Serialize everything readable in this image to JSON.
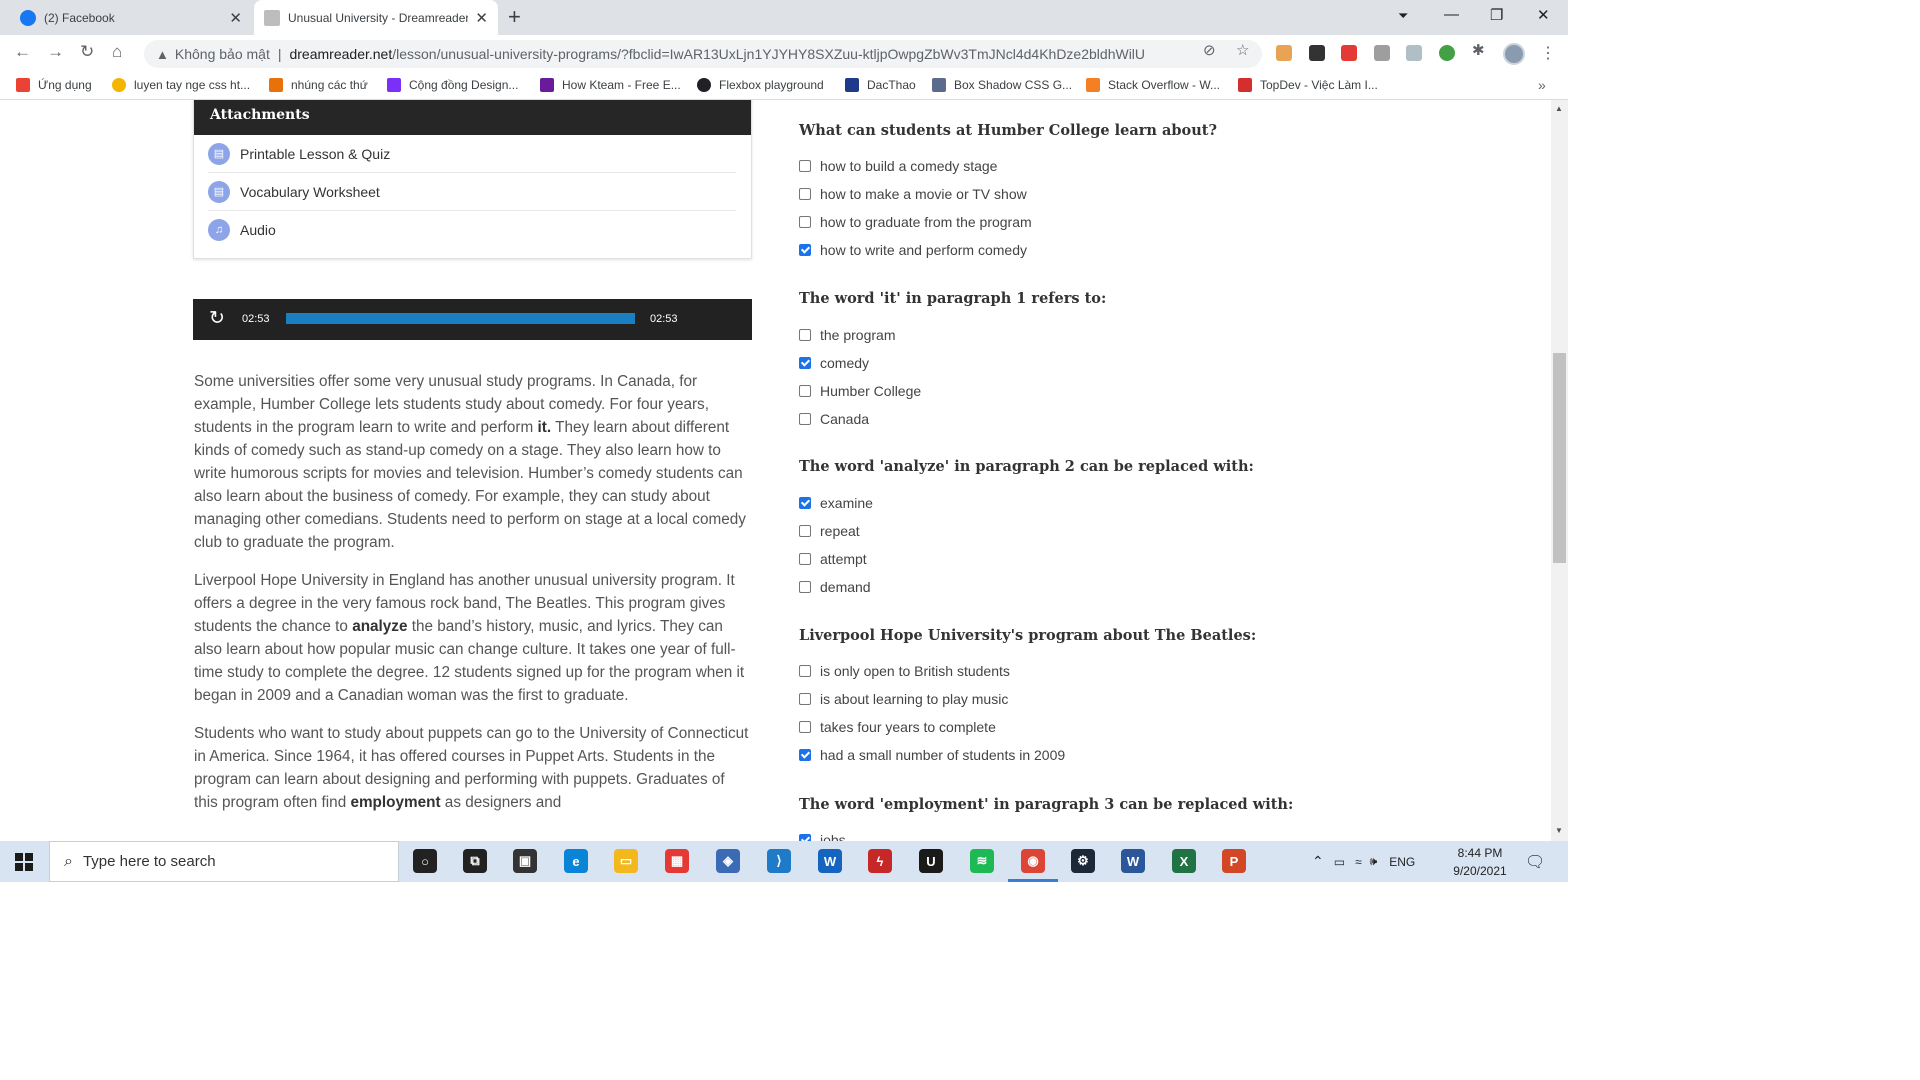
{
  "browser": {
    "tabs": [
      {
        "title": "(2) Facebook",
        "favicon_color": "#1877f2"
      },
      {
        "title": "Unusual University - Dreamreader",
        "favicon_color": "#bdbdbd"
      }
    ],
    "address": {
      "security_label": "Không bảo mật",
      "url_host": "dreamreader.net",
      "url_rest": "/lesson/unusual-university-programs/?fbclid=IwAR13UxLjn1YJYHY8SXZuu-ktljpOwpgZbWv3TmJNcl4d4KhDze2bldhWilU"
    },
    "bookmarks": [
      {
        "label": "Ứng dụng",
        "icon_color": "#ea4335"
      },
      {
        "label": "luyen tay nge css ht...",
        "icon_color": "#f4b400"
      },
      {
        "label": "nhúng các thứ",
        "icon_color": "#e8710a"
      },
      {
        "label": "Cộng đồng Design...",
        "icon_color": "#7b2ff7"
      },
      {
        "label": "How Kteam - Free E...",
        "icon_color": "#6a1b9a"
      },
      {
        "label": "Flexbox playground",
        "icon_color": "#202124"
      },
      {
        "label": "DacThao",
        "icon_color": "#1e3a8a"
      },
      {
        "label": "Box Shadow CSS G...",
        "icon_color": "#5a6b8c"
      },
      {
        "label": "Stack Overflow - W...",
        "icon_color": "#f48024"
      },
      {
        "label": "TopDev - Việc Làm I...",
        "icon_color": "#d32f2f"
      }
    ]
  },
  "attachments": {
    "title": "Attachments",
    "items": [
      {
        "label": "Printable Lesson & Quiz",
        "icon": "document-icon"
      },
      {
        "label": "Vocabulary Worksheet",
        "icon": "document-icon"
      },
      {
        "label": "Audio",
        "icon": "music-note-icon"
      }
    ]
  },
  "player": {
    "current": "02:53",
    "duration": "02:53",
    "progress": 1.0
  },
  "article": {
    "paragraphs": [
      {
        "parts": [
          {
            "text": "Some universities offer some very unusual study programs.  In Canada, for example, Humber College lets students study about comedy.  For four years, students in the program learn to write and perform "
          },
          {
            "text": "it.",
            "bold": true
          },
          {
            "text": "  They learn about different kinds of comedy such as stand-up comedy on a stage. They also learn how to write humorous scripts for movies and television.  Humber’s comedy students can also learn about the business of comedy.  For example, they can study about managing other comedians.  Students need to perform on stage at a local comedy club to graduate the program."
          }
        ]
      },
      {
        "parts": [
          {
            "text": "Liverpool Hope University in England has another unusual university program.  It offers a degree in the very famous rock band, The Beatles.  This program gives students the chance to "
          },
          {
            "text": "analyze",
            "bold": true
          },
          {
            "text": " the band’s history, music, and lyrics.  They can also learn about how popular music can change culture.  It takes one year of full-time study to complete the degree.  12 students signed up for the program when it began in 2009 and a Canadian woman was the first to graduate."
          }
        ]
      },
      {
        "parts": [
          {
            "text": "Students who want to study about puppets can go to the University of Connecticut in America.  Since 1964, it has offered courses in Puppet Arts.  Students in the program can learn about designing and performing with puppets.  Graduates of this program often find "
          },
          {
            "text": "employment",
            "bold": true
          },
          {
            "text": " as designers and"
          }
        ]
      }
    ]
  },
  "quiz": [
    {
      "question": "What can students at Humber College learn about?",
      "options": [
        {
          "label": "how to build a comedy stage",
          "checked": false
        },
        {
          "label": "how to make a movie or TV show",
          "checked": false
        },
        {
          "label": "how to graduate from the program",
          "checked": false
        },
        {
          "label": "how to write and perform comedy",
          "checked": true
        }
      ]
    },
    {
      "question": "The word 'it' in paragraph 1 refers to:",
      "options": [
        {
          "label": "the program",
          "checked": false
        },
        {
          "label": "comedy",
          "checked": true
        },
        {
          "label": "Humber College",
          "checked": false
        },
        {
          "label": "Canada",
          "checked": false
        }
      ]
    },
    {
      "question": "The word 'analyze' in paragraph 2 can be replaced with:",
      "options": [
        {
          "label": "examine",
          "checked": true
        },
        {
          "label": "repeat",
          "checked": false
        },
        {
          "label": "attempt",
          "checked": false
        },
        {
          "label": "demand",
          "checked": false
        }
      ]
    },
    {
      "question": "Liverpool Hope University's program about The Beatles:",
      "options": [
        {
          "label": "is only open to British students",
          "checked": false
        },
        {
          "label": "is about learning to play music",
          "checked": false
        },
        {
          "label": "takes four years to complete",
          "checked": false
        },
        {
          "label": "had a small number of students in 2009",
          "checked": true
        }
      ]
    },
    {
      "question": "The word 'employment' in paragraph 3 can be replaced with:",
      "options": [
        {
          "label": "jobs",
          "checked": true
        }
      ]
    }
  ],
  "taskbar": {
    "search_placeholder": "Type here to search",
    "language": "ENG",
    "time": "8:44 PM",
    "date": "9/20/2021",
    "notification_count": "1",
    "apps": [
      {
        "name": "cortana-icon",
        "color": "#222222",
        "glyph": "○"
      },
      {
        "name": "task-view-icon",
        "color": "#222222",
        "glyph": "⧉"
      },
      {
        "name": "store-icon",
        "color": "#333333",
        "glyph": "▣"
      },
      {
        "name": "edge-icon",
        "color": "#0a84d6",
        "glyph": "e"
      },
      {
        "name": "file-explorer-icon",
        "color": "#f2b81d",
        "glyph": "▭"
      },
      {
        "name": "paint-icon",
        "color": "#e53935",
        "glyph": "▦"
      },
      {
        "name": "virtualbox-icon",
        "color": "#3b6bb5",
        "glyph": "◈"
      },
      {
        "name": "vscode-icon",
        "color": "#1f7bc7",
        "glyph": "⟩"
      },
      {
        "name": "wps-icon",
        "color": "#1565c0",
        "glyph": "W"
      },
      {
        "name": "filezilla-icon",
        "color": "#c62828",
        "glyph": "ϟ"
      },
      {
        "name": "upwork-icon",
        "color": "#1a1a1a",
        "glyph": "U"
      },
      {
        "name": "spotify-icon",
        "color": "#1db954",
        "glyph": "≋"
      },
      {
        "name": "chrome-icon",
        "color": "#db4437",
        "glyph": "◉"
      },
      {
        "name": "steam-icon",
        "color": "#1b2838",
        "glyph": "⚙"
      },
      {
        "name": "word-icon",
        "color": "#2b579a",
        "glyph": "W"
      },
      {
        "name": "excel-icon",
        "color": "#217346",
        "glyph": "X"
      },
      {
        "name": "powerpoint-icon",
        "color": "#d24726",
        "glyph": "P"
      }
    ]
  }
}
